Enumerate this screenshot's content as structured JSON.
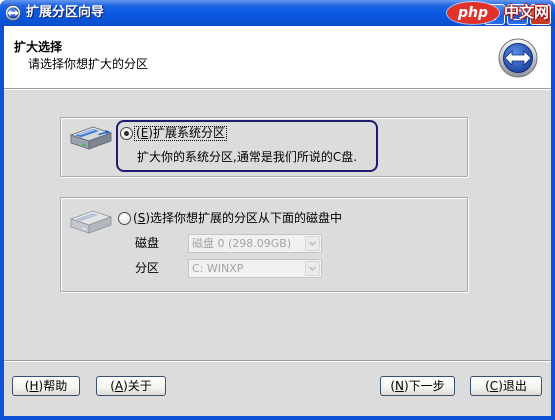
{
  "window": {
    "title": "扩展分区向导",
    "icon": "expand-arrows-icon",
    "controls": {
      "minimize": "minimize-icon",
      "maximize": "maximize-icon",
      "close": "close-icon"
    }
  },
  "watermark": {
    "logo": "php",
    "text": "中文网"
  },
  "header": {
    "title": "扩大选择",
    "subtitle": "请选择你想扩大的分区",
    "icon": "expand-arrows-icon"
  },
  "options": {
    "system": {
      "label": "(E)扩展系统分区",
      "description": "扩大你的系统分区,通常是我们所说的C盘.",
      "selected": true,
      "icon": "hard-drive-icon"
    },
    "custom": {
      "label": "(S)选择你想扩展的分区从下面的磁盘中",
      "selected": false,
      "icon": "hard-drive-icon",
      "disk": {
        "label": "磁盘",
        "value": "磁盘 0 (298.09GB)",
        "disabled": true
      },
      "partition": {
        "label": "分区",
        "value": "C: WINXP",
        "disabled": true
      }
    }
  },
  "footer": {
    "help": "(H)帮助",
    "about": "(A)关于",
    "next": "(N)下一步",
    "exit": "(C)退出"
  },
  "colors": {
    "titlebar": "#0A58E2",
    "frame": "#0B52D8",
    "dialog_body": "#DCDCDC",
    "header_bg": "#FFFFFF",
    "annotation": "#1D1D6F",
    "disabled_text": "#A3A3A3",
    "watermark": "#E2322C"
  }
}
